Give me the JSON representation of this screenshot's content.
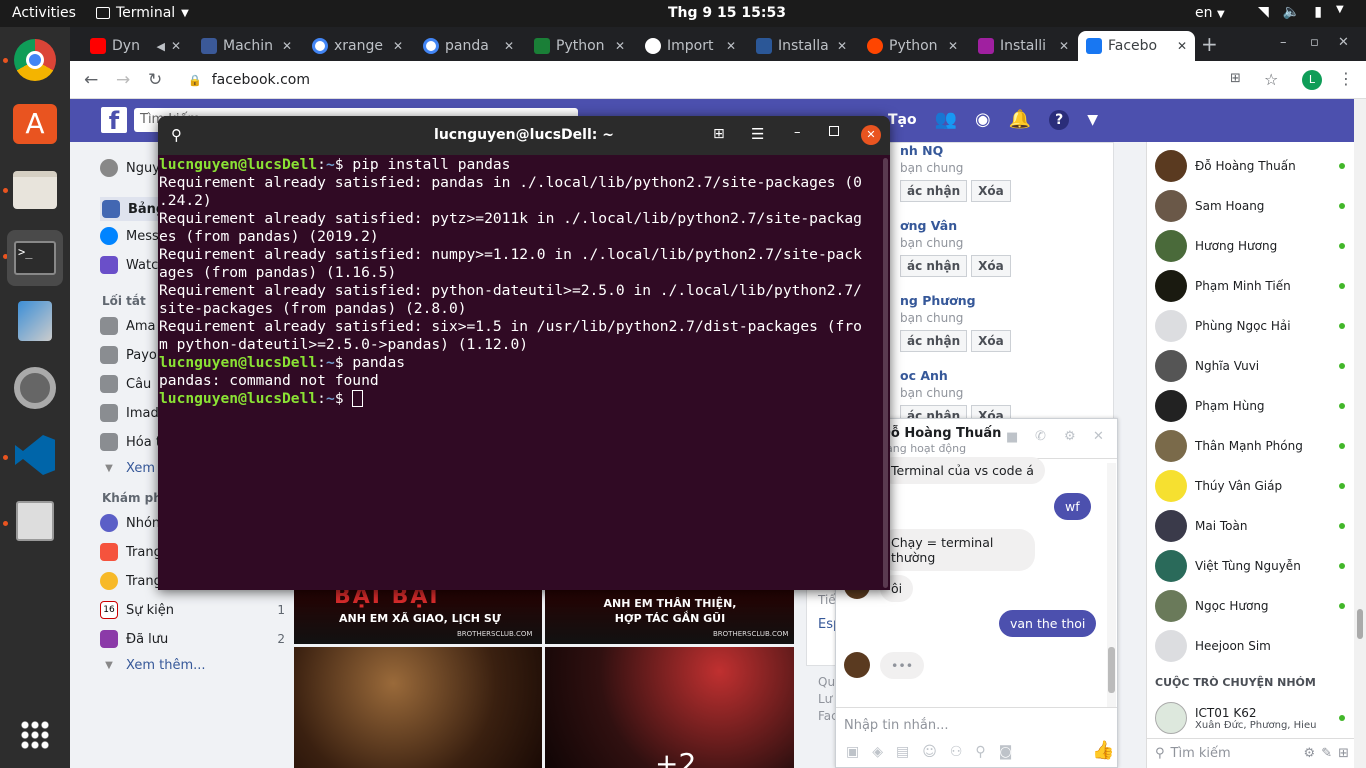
{
  "topbar": {
    "activities": "Activities",
    "app_name": "Terminal",
    "clock": "Thg 9 15  15:53",
    "lang": "en"
  },
  "browser": {
    "tabs": [
      {
        "label": "Dyn",
        "color": "#ff0000"
      },
      {
        "label": "Machin",
        "color": "#3b5998"
      },
      {
        "label": "xrange",
        "color": "#4285f4"
      },
      {
        "label": "panda",
        "color": "#4285f4"
      },
      {
        "label": "Python",
        "color": "#1a7f37"
      },
      {
        "label": "Import",
        "color": "#ffffff"
      },
      {
        "label": "Installa",
        "color": "#2b5797"
      },
      {
        "label": "Python",
        "color": "#ff4500"
      },
      {
        "label": "Installi",
        "color": "#a020a0"
      },
      {
        "label": "Facebo",
        "color": "#1877f2"
      }
    ],
    "url": "facebook.com",
    "profile_initial": "L"
  },
  "fb": {
    "search_placeholder": "Tìm kiếm",
    "create_label": "Tạo",
    "left": {
      "user": "Nguy",
      "items": [
        {
          "label": "Bảng"
        },
        {
          "label": "Mess"
        },
        {
          "label": "Watc"
        }
      ],
      "shortcuts_title": "Lối tắt",
      "shortcuts": [
        {
          "label": "Ama"
        },
        {
          "label": "Payo"
        },
        {
          "label": "Câu"
        },
        {
          "label": "Imad"
        },
        {
          "label": "Hóa t"
        }
      ],
      "see_more_1": "Xem",
      "explore_title": "Khám ph",
      "explore": [
        {
          "label": "Nhón",
          "count": ""
        },
        {
          "label": "Trang",
          "count": ""
        },
        {
          "label": "Trang",
          "count": ""
        },
        {
          "label": "Sự kiện",
          "count": "1"
        },
        {
          "label": "Đã lưu",
          "count": "2"
        }
      ],
      "see_more_2": "Xem thêm..."
    },
    "requests": [
      {
        "name": "nh NQ",
        "mutual": "bạn chung",
        "confirm": "ác nhận",
        "delete": "Xóa"
      },
      {
        "name": "ơng Vân",
        "mutual": "bạn chung",
        "confirm": "ác nhận",
        "delete": "Xóa"
      },
      {
        "name": "ng Phương",
        "mutual": "bạn chung",
        "confirm": "ác nhận",
        "delete": "Xóa"
      },
      {
        "name": "oc Anh",
        "mutual": "bạn chung",
        "confirm": "ác nhận",
        "delete": "Xóa"
      }
    ],
    "mid_snips": [
      "Tiế",
      "Esp",
      "Qu",
      "Lư",
      "Fac"
    ],
    "photo_texts": [
      "ANH EM XÃ GIAO, LỊCH SỰ",
      "ANH EM THÂN THIỆN, HỢP TÁC GẮN GŨI",
      "BROTHERSCLUB.COM",
      "+2"
    ],
    "contacts": [
      {
        "name": "Đỗ Hoàng Thuấn"
      },
      {
        "name": "Sam Hoang"
      },
      {
        "name": "Hương Hương"
      },
      {
        "name": "Phạm Minh Tiến"
      },
      {
        "name": "Phùng Ngọc Hải"
      },
      {
        "name": "Nghĩa Vuvi"
      },
      {
        "name": "Phạm Hùng"
      },
      {
        "name": "Thân Mạnh Phóng"
      },
      {
        "name": "Thúy Vân Giáp"
      },
      {
        "name": "Mai Toàn"
      },
      {
        "name": "Việt Tùng Nguyễn"
      },
      {
        "name": "Ngọc Hương"
      },
      {
        "name": "Heejoon Sim"
      }
    ],
    "group_title": "CUỘC TRÒ CHUYỆN NHÓM",
    "group": {
      "name": "ICT01 K62",
      "members": "Xuân Đức, Phương, Hieu"
    },
    "contact_search": "Tìm kiếm",
    "chat": {
      "name": "Đỗ Hoàng Thuấn",
      "status": "ang hoạt động",
      "messages": [
        {
          "dir": "in",
          "text": "Terminal của vs code á"
        },
        {
          "dir": "out",
          "text": "wf"
        },
        {
          "dir": "in",
          "text": "Chạy = terminal thường"
        },
        {
          "dir": "in",
          "text": "ôi"
        },
        {
          "dir": "out",
          "text": "van the thoi"
        },
        {
          "dir": "in",
          "text": "•••"
        }
      ],
      "input_placeholder": "Nhập tin nhắn..."
    }
  },
  "terminal": {
    "title": "lucnguyen@lucsDell: ~",
    "user": "lucnguyen@lucsDell",
    "path": "~",
    "lines": [
      {
        "type": "cmd",
        "text": " pip install pandas"
      },
      {
        "type": "out",
        "text": "Requirement already satisfied: pandas in ./.local/lib/python2.7/site-packages (0\n.24.2)"
      },
      {
        "type": "out",
        "text": "Requirement already satisfied: pytz>=2011k in ./.local/lib/python2.7/site-packag\nes (from pandas) (2019.2)"
      },
      {
        "type": "out",
        "text": "Requirement already satisfied: numpy>=1.12.0 in ./.local/lib/python2.7/site-pack\nages (from pandas) (1.16.5)"
      },
      {
        "type": "out",
        "text": "Requirement already satisfied: python-dateutil>=2.5.0 in ./.local/lib/python2.7/\nsite-packages (from pandas) (2.8.0)"
      },
      {
        "type": "out",
        "text": "Requirement already satisfied: six>=1.5 in /usr/lib/python2.7/dist-packages (fro\nm python-dateutil>=2.5.0->pandas) (1.12.0)"
      },
      {
        "type": "cmd",
        "text": " pandas"
      },
      {
        "type": "out",
        "text": "pandas: command not found"
      },
      {
        "type": "cmd",
        "text": " "
      }
    ]
  }
}
